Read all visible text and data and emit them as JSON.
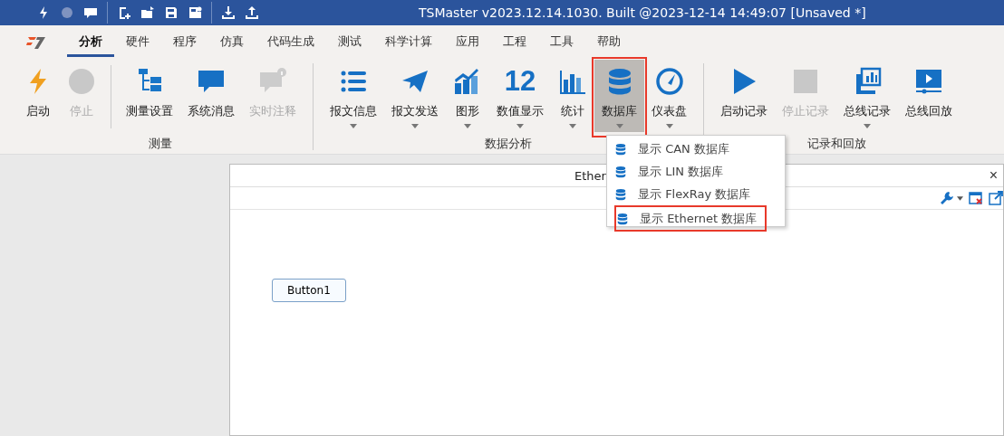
{
  "title_bar": {
    "title": "TSMaster v2023.12.14.1030. Built @2023-12-14 14:49:07 [Unsaved *]",
    "quick_tools": [
      {
        "kind": "bolt"
      },
      {
        "kind": "circle"
      },
      {
        "kind": "chat"
      },
      {
        "kind": "sep"
      },
      {
        "kind": "new"
      },
      {
        "kind": "open"
      },
      {
        "kind": "save"
      },
      {
        "kind": "saveas"
      },
      {
        "kind": "sep"
      },
      {
        "kind": "download"
      },
      {
        "kind": "upload"
      }
    ]
  },
  "menu_tabs": [
    {
      "label": "分析",
      "selected": true
    },
    {
      "label": "硬件",
      "selected": false
    },
    {
      "label": "程序",
      "selected": false
    },
    {
      "label": "仿真",
      "selected": false
    },
    {
      "label": "代码生成",
      "selected": false
    },
    {
      "label": "测试",
      "selected": false
    },
    {
      "label": "科学计算",
      "selected": false
    },
    {
      "label": "应用",
      "selected": false
    },
    {
      "label": "工程",
      "selected": false
    },
    {
      "label": "工具",
      "selected": false
    },
    {
      "label": "帮助",
      "selected": false
    }
  ],
  "ribbon_groups": [
    {
      "label": "测量",
      "items": [
        {
          "kind": "bolt",
          "label": "启动",
          "disabled": false,
          "dropdown": false,
          "selected": false,
          "highlighted": false
        },
        {
          "kind": "stop-circle",
          "label": "停止",
          "disabled": true,
          "dropdown": false,
          "selected": false,
          "highlighted": false
        },
        {
          "kind": "sep"
        },
        {
          "kind": "tree",
          "label": "测量设置",
          "disabled": false,
          "dropdown": false,
          "selected": false,
          "highlighted": false
        },
        {
          "kind": "chat",
          "label": "系统消息",
          "disabled": false,
          "dropdown": false,
          "selected": false,
          "highlighted": false
        },
        {
          "kind": "chat-info",
          "label": "实时注释",
          "disabled": true,
          "dropdown": false,
          "selected": false,
          "highlighted": false
        }
      ]
    },
    {
      "label": "数据分析",
      "items": [
        {
          "kind": "list",
          "label": "报文信息",
          "disabled": false,
          "dropdown": true,
          "selected": false,
          "highlighted": false
        },
        {
          "kind": "plane",
          "label": "报文发送",
          "disabled": false,
          "dropdown": true,
          "selected": false,
          "highlighted": false
        },
        {
          "kind": "graph",
          "label": "图形",
          "disabled": false,
          "dropdown": true,
          "selected": false,
          "highlighted": false
        },
        {
          "kind": "number",
          "label": "数值显示",
          "icon_text": "12",
          "disabled": false,
          "dropdown": true,
          "selected": false,
          "highlighted": false
        },
        {
          "kind": "bars",
          "label": "统计",
          "disabled": false,
          "dropdown": true,
          "selected": false,
          "highlighted": false
        },
        {
          "kind": "database",
          "label": "数据库",
          "disabled": false,
          "dropdown": true,
          "selected": true,
          "highlighted": true
        },
        {
          "kind": "gauge",
          "label": "仪表盘",
          "disabled": false,
          "dropdown": true,
          "selected": false,
          "highlighted": false
        }
      ]
    },
    {
      "label": "记录和回放",
      "items": [
        {
          "kind": "play",
          "label": "启动记录",
          "disabled": false,
          "dropdown": false,
          "selected": false,
          "highlighted": false
        },
        {
          "kind": "square",
          "label": "停止记录",
          "disabled": true,
          "dropdown": false,
          "selected": false,
          "highlighted": false
        },
        {
          "kind": "record",
          "label": "总线记录",
          "disabled": false,
          "dropdown": true,
          "selected": false,
          "highlighted": false
        },
        {
          "kind": "video",
          "label": "总线回放",
          "disabled": false,
          "dropdown": false,
          "selected": false,
          "highlighted": false
        }
      ]
    }
  ],
  "dropdown_menu": [
    {
      "label": "显示 CAN 数据库",
      "highlighted": false
    },
    {
      "label": "显示 LIN 数据库",
      "highlighted": false
    },
    {
      "label": "显示 FlexRay 数据库",
      "highlighted": false
    },
    {
      "label": "显示 Ethernet 数据库",
      "highlighted": true
    }
  ],
  "panel": {
    "title": "Ether",
    "close": "×",
    "button": "Button1"
  }
}
